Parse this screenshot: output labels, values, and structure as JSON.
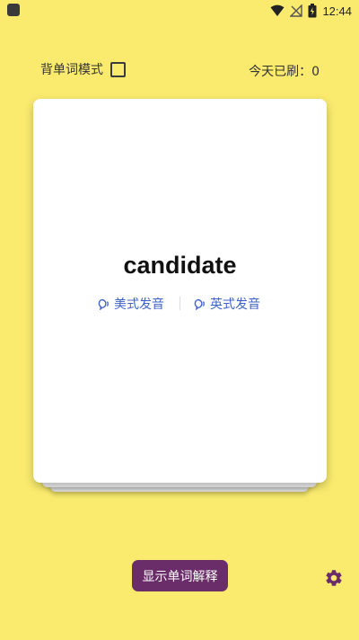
{
  "status_bar": {
    "time": "12:44"
  },
  "mode": {
    "label": "背单词模式"
  },
  "today": {
    "label": "今天已刷：0"
  },
  "card": {
    "word": "candidate",
    "pron_us": "美式发音",
    "pron_uk": "英式发音"
  },
  "actions": {
    "show_explanation": "显示单词解释"
  },
  "colors": {
    "background": "#FAEB6E",
    "accent": "#6B2D69",
    "link": "#3F62C8"
  },
  "icons": [
    "wifi-icon",
    "signal-off-icon",
    "battery-icon",
    "speaker-icon",
    "gear-icon"
  ]
}
